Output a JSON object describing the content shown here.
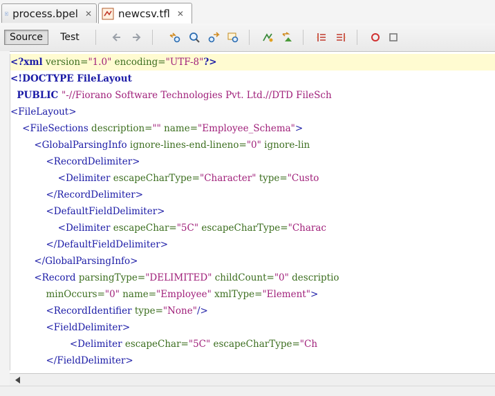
{
  "tabs": [
    {
      "label": "process.bpel",
      "icon": "bpel-file-icon",
      "active": false
    },
    {
      "label": "newcsv.tfl",
      "icon": "tfl-file-icon",
      "active": true
    }
  ],
  "toolbar": {
    "source_label": "Source",
    "test_label": "Test",
    "icons": [
      "back-icon",
      "forward-icon",
      "find-prev-icon",
      "find-icon",
      "find-next-icon",
      "find-selection-icon",
      "toggle-bookmark-icon",
      "next-bookmark-icon",
      "shift-left-icon",
      "shift-right-icon",
      "record-macro-icon",
      "stop-macro-icon"
    ]
  },
  "colors": {
    "tag": "#1a1aa6",
    "attr": "#3c6e1f",
    "value": "#a0207a",
    "highlight": "#fffbd1"
  },
  "code_lines": [
    [
      {
        "t": "<?xml",
        "c": "tag bold"
      },
      {
        "t": " version=",
        "c": "attr"
      },
      {
        "t": "\"1.0\"",
        "c": "val"
      },
      {
        "t": " encoding=",
        "c": "attr"
      },
      {
        "t": "\"UTF-8\"",
        "c": "val"
      },
      {
        "t": "?>",
        "c": "tag bold"
      }
    ],
    [
      {
        "t": "<!DOCTYPE FileLayout",
        "c": "tag bold"
      }
    ],
    [
      {
        "t": "  PUBLIC ",
        "c": "tag bold"
      },
      {
        "t": "\"-//Fiorano Software Technologies Pvt. Ltd.//DTD FileSch",
        "c": "val"
      }
    ],
    [
      {
        "t": "<FileLayout>",
        "c": "tag"
      }
    ],
    [
      {
        "t": "    <FileSections",
        "c": "tag"
      },
      {
        "t": " description=",
        "c": "attr"
      },
      {
        "t": "\"\"",
        "c": "val"
      },
      {
        "t": " name=",
        "c": "attr"
      },
      {
        "t": "\"Employee_Schema\"",
        "c": "val"
      },
      {
        "t": ">",
        "c": "tag"
      }
    ],
    [
      {
        "t": "        <GlobalParsingInfo",
        "c": "tag"
      },
      {
        "t": " ignore-lines-end-lineno=",
        "c": "attr"
      },
      {
        "t": "\"0\"",
        "c": "val"
      },
      {
        "t": " ignore-lin",
        "c": "attr"
      }
    ],
    [
      {
        "t": "            <RecordDelimiter>",
        "c": "tag"
      }
    ],
    [
      {
        "t": "                <Delimiter",
        "c": "tag"
      },
      {
        "t": " escapeCharType=",
        "c": "attr"
      },
      {
        "t": "\"Character\"",
        "c": "val"
      },
      {
        "t": " type=",
        "c": "attr"
      },
      {
        "t": "\"Custo",
        "c": "val"
      }
    ],
    [
      {
        "t": "            </RecordDelimiter>",
        "c": "tag"
      }
    ],
    [
      {
        "t": "            <DefaultFieldDelimiter>",
        "c": "tag"
      }
    ],
    [
      {
        "t": "                <Delimiter",
        "c": "tag"
      },
      {
        "t": " escapeChar=",
        "c": "attr"
      },
      {
        "t": "\"5C\"",
        "c": "val"
      },
      {
        "t": " escapeCharType=",
        "c": "attr"
      },
      {
        "t": "\"Charac",
        "c": "val"
      }
    ],
    [
      {
        "t": "            </DefaultFieldDelimiter>",
        "c": "tag"
      }
    ],
    [
      {
        "t": "        </GlobalParsingInfo>",
        "c": "tag"
      }
    ],
    [
      {
        "t": "        <Record",
        "c": "tag"
      },
      {
        "t": " parsingType=",
        "c": "attr"
      },
      {
        "t": "\"DELIMITED\"",
        "c": "val"
      },
      {
        "t": " childCount=",
        "c": "attr"
      },
      {
        "t": "\"0\"",
        "c": "val"
      },
      {
        "t": " descriptio",
        "c": "attr"
      }
    ],
    [
      {
        "t": "            minOccurs=",
        "c": "attr"
      },
      {
        "t": "\"0\"",
        "c": "val"
      },
      {
        "t": " name=",
        "c": "attr"
      },
      {
        "t": "\"Employee\"",
        "c": "val"
      },
      {
        "t": " xmlType=",
        "c": "attr"
      },
      {
        "t": "\"Element\"",
        "c": "val"
      },
      {
        "t": ">",
        "c": "tag"
      }
    ],
    [
      {
        "t": "            <RecordIdentifier",
        "c": "tag"
      },
      {
        "t": " type=",
        "c": "attr"
      },
      {
        "t": "\"None\"",
        "c": "val"
      },
      {
        "t": "/>",
        "c": "tag"
      }
    ],
    [
      {
        "t": "            <FieldDelimiter>",
        "c": "tag"
      }
    ],
    [
      {
        "t": "                    <Delimiter",
        "c": "tag"
      },
      {
        "t": " escapeChar=",
        "c": "attr"
      },
      {
        "t": "\"5C\"",
        "c": "val"
      },
      {
        "t": " escapeCharType=",
        "c": "attr"
      },
      {
        "t": "\"Ch",
        "c": "val"
      }
    ],
    [
      {
        "t": "            </FieldDelimiter>",
        "c": "tag"
      }
    ]
  ]
}
